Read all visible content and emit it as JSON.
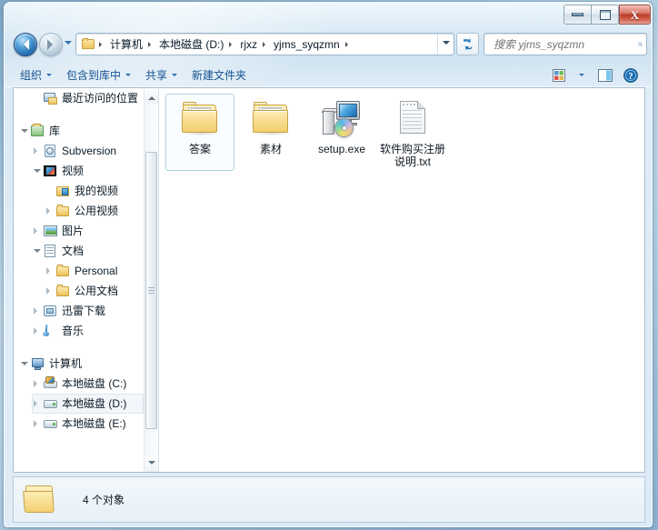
{
  "window": {
    "minimize_label": "Minimize",
    "maximize_label": "Maximize",
    "close_label": "X"
  },
  "address": {
    "breadcrumbs": [
      "计算机",
      "本地磁盘 (D:)",
      "rjxz",
      "yjms_syqzmn"
    ],
    "dropdown_label": "",
    "refresh_label": ""
  },
  "search": {
    "placeholder": "搜索 yjms_syqzmn",
    "value": ""
  },
  "toolbar": {
    "items": [
      {
        "label": "组织",
        "has_caret": true
      },
      {
        "label": "包含到库中",
        "has_caret": true
      },
      {
        "label": "共享",
        "has_caret": true
      },
      {
        "label": "新建文件夹",
        "has_caret": false
      }
    ],
    "view_label": "更改您的视图",
    "preview_label": "显示预览窗格",
    "help_label": "获取帮助"
  },
  "sidebar": {
    "items": [
      {
        "label": "最近访问的位置",
        "indent": 1,
        "expander": "none",
        "icon": "recent-places-icon"
      },
      {
        "label": "",
        "indent": 0,
        "expander": "none",
        "icon": "spacer"
      },
      {
        "label": "库",
        "indent": 0,
        "expander": "open",
        "icon": "library-icon"
      },
      {
        "label": "Subversion",
        "indent": 1,
        "expander": "closed",
        "icon": "subversion-icon"
      },
      {
        "label": "视频",
        "indent": 1,
        "expander": "open",
        "icon": "video-library-icon"
      },
      {
        "label": "我的视频",
        "indent": 2,
        "expander": "none",
        "icon": "folder-blue-icon"
      },
      {
        "label": "公用视频",
        "indent": 2,
        "expander": "closed",
        "icon": "folder-icon"
      },
      {
        "label": "图片",
        "indent": 1,
        "expander": "closed",
        "icon": "pictures-library-icon"
      },
      {
        "label": "文档",
        "indent": 1,
        "expander": "open",
        "icon": "documents-library-icon"
      },
      {
        "label": "Personal",
        "indent": 2,
        "expander": "closed",
        "icon": "folder-icon"
      },
      {
        "label": "公用文档",
        "indent": 2,
        "expander": "closed",
        "icon": "folder-icon"
      },
      {
        "label": "迅雷下载",
        "indent": 1,
        "expander": "closed",
        "icon": "download-library-icon"
      },
      {
        "label": "音乐",
        "indent": 1,
        "expander": "closed",
        "icon": "music-library-icon"
      },
      {
        "label": "",
        "indent": 0,
        "expander": "none",
        "icon": "spacer"
      },
      {
        "label": "计算机",
        "indent": 0,
        "expander": "open",
        "icon": "computer-icon"
      },
      {
        "label": "本地磁盘 (C:)",
        "indent": 1,
        "expander": "closed",
        "icon": "hard-disk-system-icon"
      },
      {
        "label": "本地磁盘 (D:)",
        "indent": 1,
        "expander": "closed",
        "icon": "hard-disk-icon",
        "selected": true
      },
      {
        "label": "本地磁盘 (E:)",
        "indent": 1,
        "expander": "closed",
        "icon": "hard-disk-icon"
      }
    ]
  },
  "files": {
    "items": [
      {
        "name": "答案",
        "type": "folder",
        "selected": true
      },
      {
        "name": "素材",
        "type": "folder",
        "selected": false
      },
      {
        "name": "setup.exe",
        "type": "exe",
        "selected": false
      },
      {
        "name": "软件购买注册说明.txt",
        "type": "text",
        "selected": false
      }
    ]
  },
  "status": {
    "text": "4 个对象"
  },
  "colors": {
    "accent": "#15528f",
    "selection": "#a9cfe8",
    "folder": "#f2cf6f",
    "close_button": "#bb3c2b"
  }
}
